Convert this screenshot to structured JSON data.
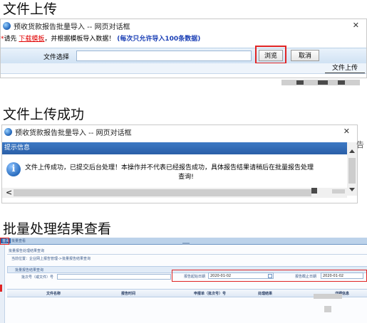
{
  "section1": {
    "title": "文件上传",
    "window_title": "预收货款报告批量导入 -- 网页对话框",
    "close_glyph": "✕",
    "notice_prefix": "请先",
    "notice_link": "下载模板",
    "notice_middle": "，并根据模板导入数据！",
    "notice_bold": "(每次只允许导入100条数据)",
    "file_label": "文件选择",
    "browse_button": "浏览",
    "cancel_button": "取消",
    "upload_button": "文件上传"
  },
  "section2": {
    "title": "文件上传成功",
    "window_title": "预收货款报告批量导入 -- 网页对话框",
    "close_glyph": "✕",
    "header": "提示信息",
    "message_line1": "文件上传成功，已提交后台处理！本操作并不代表已经报告成功，具体报告结果请稍后在批量报告处理",
    "message_line2": "查询!",
    "info_glyph": "i",
    "scroll_left_glyph": "<",
    "side_text": "告"
  },
  "section3": {
    "title": "批量处理结果查看",
    "tab_active": "首页",
    "tab_other": "批量查看",
    "panel_title": "批量报告处理结果查询",
    "breadcrumb": "当前位置：企业网上报告管理->批量报告结果查询",
    "search_header": "批量报告结果查询",
    "filter1_label": "批次号（或文件）号",
    "filter2_label": "报告起始日期",
    "filter2_value": "2020-01-02",
    "filter3_label": "报告截止日期",
    "filter3_value": "2020-01-02",
    "col1": "文件名称",
    "col2": "报告时间",
    "col3": "申报单（批次号）号",
    "col4": "处理结果",
    "col5": "详细信息"
  },
  "colors": {
    "link_red": "#e00000",
    "bold_blue": "#1a3fb5",
    "highlight_red": "#e02424",
    "info_blue": "#2b6ebf"
  }
}
